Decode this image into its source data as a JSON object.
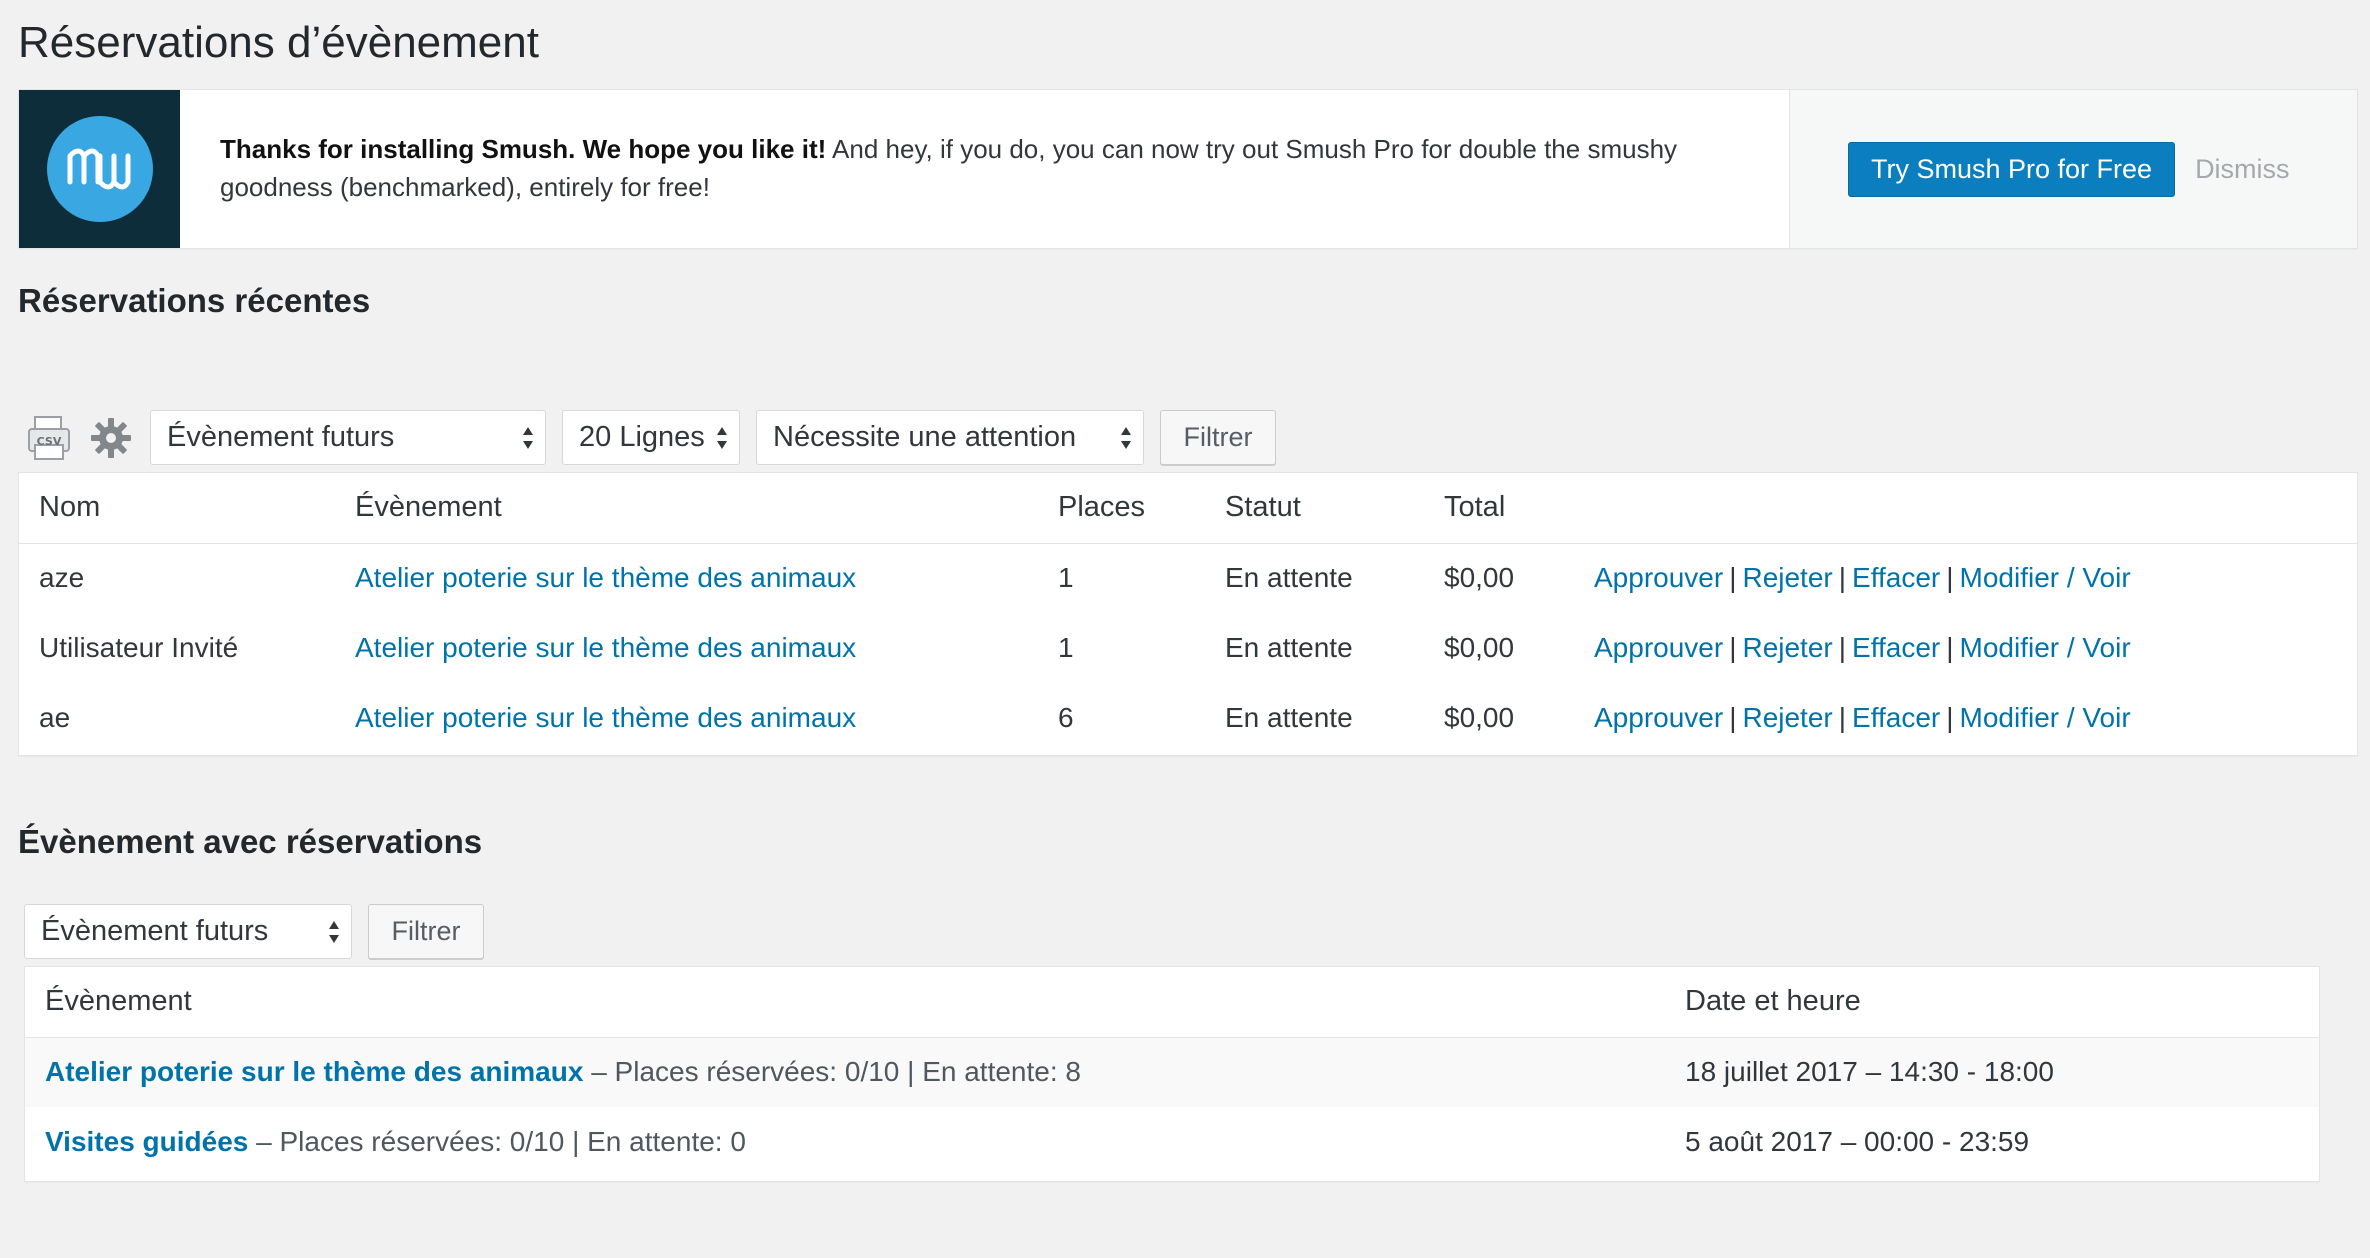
{
  "page_title": "Réservations d’évènement",
  "notice": {
    "bold_text": "Thanks for installing Smush. We hope you like it!",
    "text": " And hey, if you do, you can now try out Smush Pro for double the smushy goodness (benchmarked), entirely for free!",
    "primary_button": "Try Smush Pro for Free",
    "dismiss": "Dismiss"
  },
  "recent": {
    "title": "Réservations récentes",
    "csv_icon": "csv-export-icon",
    "settings_icon": "gear-icon",
    "scope_select": "Évènement futurs",
    "rows_select": "20 Lignes",
    "status_select": "Nécessite une attention",
    "filter_button": "Filtrer",
    "columns": [
      "Nom",
      "Évènement",
      "Places",
      "Statut",
      "Total"
    ],
    "actions": [
      "Approuver",
      "Rejeter",
      "Effacer",
      "Modifier / Voir"
    ],
    "rows": [
      {
        "name": "aze",
        "event": "Atelier poterie sur le thème des animaux",
        "places": "1",
        "status": "En attente",
        "total": "$0,00"
      },
      {
        "name": "Utilisateur Invité",
        "event": "Atelier poterie sur le thème des animaux",
        "places": "1",
        "status": "En attente",
        "total": "$0,00"
      },
      {
        "name": "ae",
        "event": "Atelier poterie sur le thème des animaux",
        "places": "6",
        "status": "En attente",
        "total": "$0,00"
      }
    ]
  },
  "events": {
    "title": "Évènement avec réservations",
    "scope_select": "Évènement futurs",
    "filter_button": "Filtrer",
    "columns": [
      "Évènement",
      "Date et heure"
    ],
    "rows": [
      {
        "event": "Atelier poterie sur le thème des animaux",
        "details": " – Places réservées: 0/10 | En attente: 8",
        "date": "18 juillet 2017 – 14:30 - 18:00"
      },
      {
        "event": "Visites guidées",
        "details": " – Places réservées: 0/10 | En attente: 0",
        "date": "5 août 2017 – 00:00 - 23:59"
      }
    ]
  },
  "colors": {
    "link": "#0073aa",
    "primary": "#0a7ebf",
    "logo_bg": "#0e2d3a",
    "logo_circle": "#39a7e2"
  }
}
